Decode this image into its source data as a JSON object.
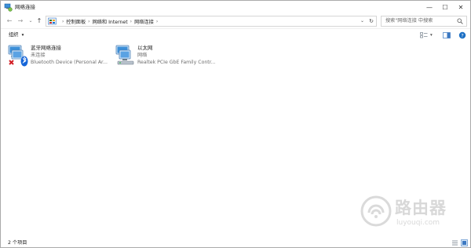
{
  "window": {
    "title": "网络连接",
    "controls": {
      "minimize": "—",
      "maximize": "☐",
      "close": "✕"
    }
  },
  "nav": {
    "back": "←",
    "forward": "→",
    "recent": "⌄",
    "up": "↑",
    "breadcrumbs": [
      "控制面板",
      "网络和 Internet",
      "网络连接"
    ],
    "dropdown_glyph": "⌄",
    "refresh_glyph": "↻",
    "search_placeholder": "搜索\"网络连接 中搜索"
  },
  "toolbar": {
    "organize_label": "组织",
    "organize_caret": "▾",
    "view_caret": "▾"
  },
  "connections": [
    {
      "name": "蓝牙网络连接",
      "status": "未连接",
      "device": "Bluetooth Device (Personal Ar...",
      "icon": "bluetooth-network-disconnected-icon"
    },
    {
      "name": "以太网",
      "status": "网络",
      "device": "Realtek PCIe GbE Family Contr...",
      "icon": "ethernet-network-icon"
    }
  ],
  "statusbar": {
    "item_count": "2 个项目"
  },
  "watermark": {
    "name": "路由器",
    "url": "luyouqi.com"
  },
  "colors": {
    "accent_blue": "#1c6fc4",
    "bluetooth_blue": "#1565d8",
    "error_red": "#d21f26",
    "text_gray": "#6d6d6d"
  }
}
